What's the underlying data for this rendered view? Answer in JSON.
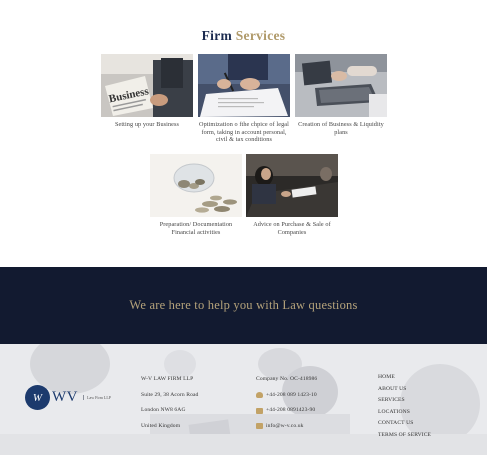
{
  "section": {
    "title_a": "Firm",
    "title_b": "Services"
  },
  "services": [
    {
      "caption": "Setting up your Business",
      "image": "business-newspaper-photo"
    },
    {
      "caption": "Optimization o fthe chpice of legal form, taking in account personal, civil & tax conditions",
      "image": "signing-document-photo"
    },
    {
      "caption": "Creation of Business & Liquidity plans",
      "image": "laptop-meeting-photo"
    },
    {
      "caption": "Preparation/ Documentation Financial activities",
      "image": "coin-jar-photo"
    },
    {
      "caption": "Advice on Purchase & Sale of Companies",
      "image": "business-meeting-photo"
    }
  ],
  "banner": {
    "text": "We are here to help you with Law questions"
  },
  "footer": {
    "logo": {
      "mark": "W",
      "name": "WV",
      "subtitle": "Law Firm LLP"
    },
    "address": {
      "line1": "W-V LAW FIRM LLP",
      "line2": "Suite 29, 38 Acorn Road",
      "line3": "London NW8 6AG",
      "line4": "United Kingdom"
    },
    "contact": {
      "company": "Company No. OC-418986",
      "phone1": "+44-208 089 1423-10",
      "phone2": "+44-208 0891423-90",
      "email": "info@w-v.co.uk"
    },
    "links": [
      "HOME",
      "ABOUT US",
      "SERVICES",
      "LOCATIONS",
      "CONTACT US",
      "TERMS OF SERVICE"
    ]
  },
  "colors": {
    "navy": "#121a30",
    "gold": "#b09a6a",
    "logo_blue": "#1c3a6d"
  }
}
